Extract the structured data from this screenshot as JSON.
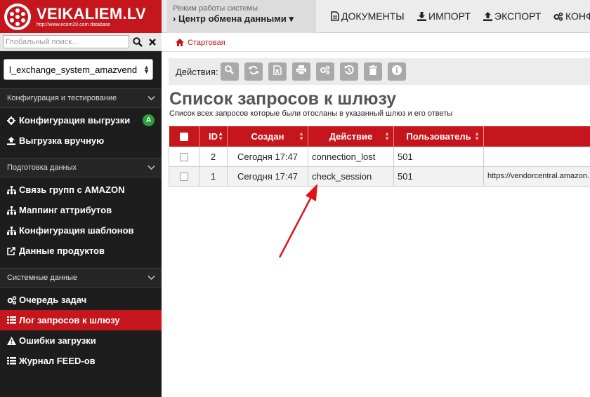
{
  "brand": {
    "title": "VEIKALIEM.LV",
    "subtitle": "http://www.ecom20.com database"
  },
  "search": {
    "placeholder": "Глобальный поиск..."
  },
  "system_select": {
    "value": "l_exchange_system_amazvend"
  },
  "sidebar": {
    "sections": [
      {
        "label": "Конфигурация и тестирование",
        "items": [
          {
            "label": "Конфигурация выгрузки",
            "icon": "gear-icon",
            "badge": "A"
          },
          {
            "label": "Выгрузка вручную",
            "icon": "upload-icon"
          }
        ]
      },
      {
        "label": "Подготовка данных",
        "items": [
          {
            "label": "Связь групп с AMAZON",
            "icon": "sitemap-icon"
          },
          {
            "label": "Маппинг аттрибутов",
            "icon": "sitemap-icon"
          },
          {
            "label": "Конфигурация шаблонов",
            "icon": "sitemap-icon"
          },
          {
            "label": "Данные продуктов",
            "icon": "external-link-icon"
          }
        ]
      },
      {
        "label": "Системные данные",
        "items": [
          {
            "label": "Очередь задач",
            "icon": "gears-icon"
          },
          {
            "label": "Лог запросов к шлюзу",
            "icon": "list-icon",
            "active": true
          },
          {
            "label": "Ошибки загрузки",
            "icon": "warning-icon"
          },
          {
            "label": "Журнал FEED-ов",
            "icon": "list-icon"
          }
        ]
      }
    ]
  },
  "topbar": {
    "mode_label": "Режим работы системы",
    "mode_value": "› Центр обмена данными ▾",
    "links": [
      "ДОКУМЕНТЫ",
      "ИМПОРТ",
      "ЭКСПОРТ",
      "КОНФ"
    ]
  },
  "breadcrumb": {
    "home": "Стартовая"
  },
  "actions": {
    "label": "Действия:"
  },
  "page": {
    "title": "Список запросов к шлюзу",
    "subtitle": "Список всех запросов которые были отосланы в указанный шлюз и его ответы"
  },
  "table": {
    "columns": [
      "ID",
      "Создан",
      "Действие",
      "Пользователь",
      ""
    ],
    "rows": [
      {
        "id": "2",
        "created": "Сегодня 17:47",
        "action": "connection_lost",
        "user": "501",
        "url": ""
      },
      {
        "id": "1",
        "created": "Сегодня 17:47",
        "action": "check_session",
        "user": "501",
        "url": "https://vendorcentral.amazon."
      }
    ]
  },
  "colors": {
    "brand_red": "#c4161c",
    "annotation_arrow": "#e0141b"
  }
}
